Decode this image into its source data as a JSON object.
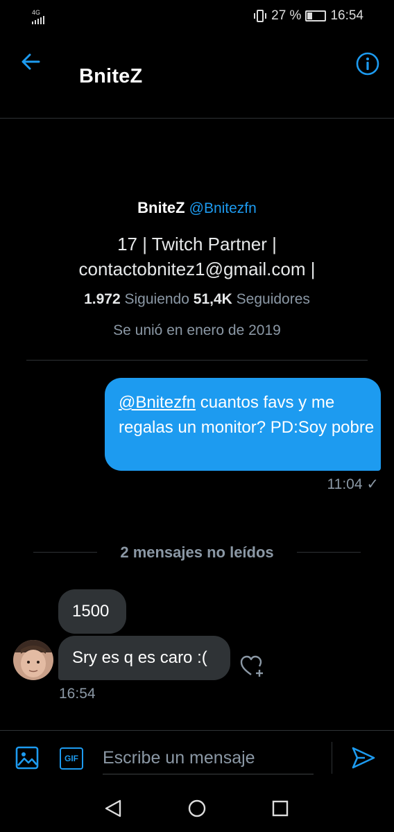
{
  "status_bar": {
    "network": "4G",
    "battery_percent": "27 %",
    "time": "16:54"
  },
  "header": {
    "title": "BniteZ"
  },
  "profile": {
    "name": "BniteZ",
    "handle": "@Bnitezfn",
    "bio_line1": "17 | Twitch Partner |",
    "bio_line2": "contactobnitez1@gmail.com |",
    "following_count": "1.972",
    "following_label": "Siguiendo",
    "followers_count": "51,4K",
    "followers_label": "Seguidores",
    "joined": "Se unió en enero de 2019"
  },
  "messages": {
    "outgoing": {
      "mention": "@Bnitezfn",
      "text": " cuantos favs y me regalas un monitor? PD:Soy pobre",
      "time": "11:04",
      "status_icon": "✓"
    },
    "unread_separator": "2 mensajes no leídos",
    "incoming": [
      {
        "text": "1500"
      },
      {
        "text": "Sry es q es caro :("
      }
    ],
    "incoming_time": "16:54"
  },
  "composer": {
    "placeholder": "Escribe un mensaje",
    "gif_label": "GIF"
  },
  "colors": {
    "accent": "#1d9bf0",
    "background": "#000000",
    "bubble_in": "#2f3336",
    "muted_text": "#8b98a5"
  }
}
